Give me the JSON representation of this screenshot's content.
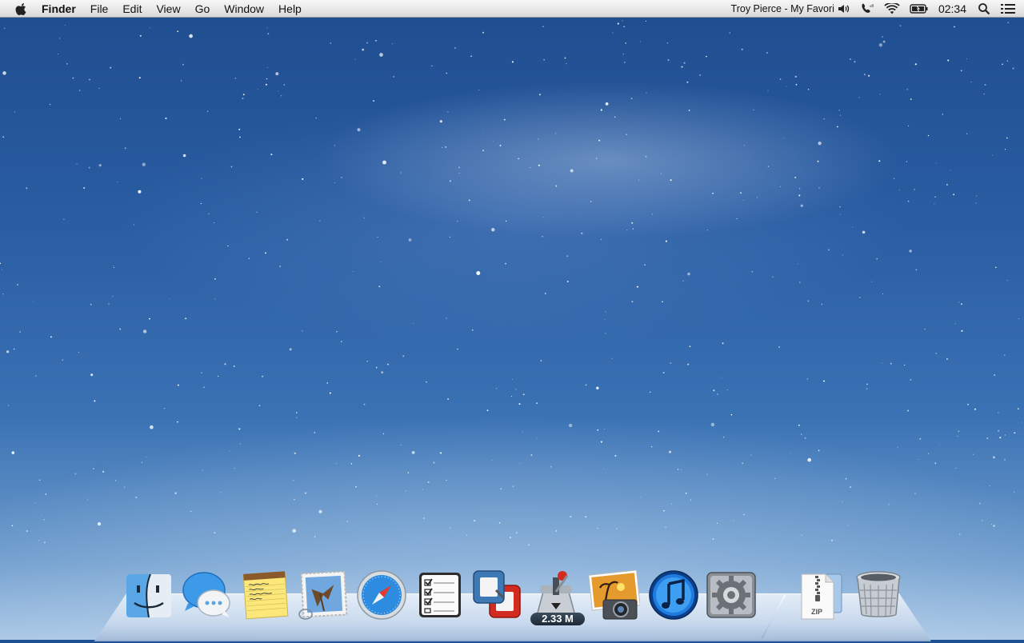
{
  "menubar": {
    "app_name": "Finder",
    "menus": [
      "File",
      "Edit",
      "View",
      "Go",
      "Window",
      "Help"
    ],
    "now_playing": "Troy Pierce - My Favori",
    "clock": "02:34"
  },
  "dock": {
    "apps": [
      {
        "name": "Finder",
        "icon": "finder-icon"
      },
      {
        "name": "Messages",
        "icon": "messages-icon"
      },
      {
        "name": "Notes",
        "icon": "notes-icon"
      },
      {
        "name": "Mail",
        "icon": "mail-icon"
      },
      {
        "name": "Safari",
        "icon": "safari-icon"
      },
      {
        "name": "Reminders",
        "icon": "reminders-icon"
      },
      {
        "name": "VMware Fusion",
        "icon": "vmware-icon"
      },
      {
        "name": "Transmission",
        "icon": "transmission-icon"
      },
      {
        "name": "iPhoto",
        "icon": "iphoto-icon"
      },
      {
        "name": "iTunes",
        "icon": "itunes-icon"
      },
      {
        "name": "System Preferences",
        "icon": "gear-icon"
      },
      {
        "name": "Archive",
        "icon": "zip-icon"
      },
      {
        "name": "Trash",
        "icon": "trash-icon"
      }
    ],
    "transmission_badge": "2.33 M",
    "zip_label": "ZIP"
  }
}
